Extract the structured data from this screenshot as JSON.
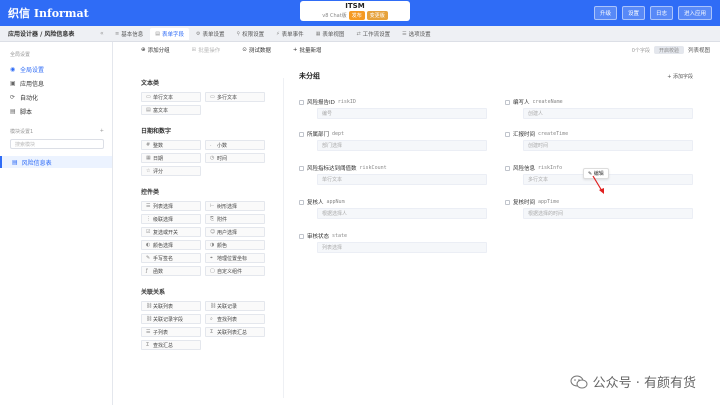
{
  "header": {
    "logo_text": "织信 Informat",
    "app_title": "ITSM",
    "version": "v8 Chat版",
    "badge_publish": "发布",
    "badge_update": "变更版",
    "actions": [
      "升级",
      "设置",
      "日志",
      "进入应用"
    ]
  },
  "tabbar": {
    "breadcrumb": "应用设计器 / 风险信息表",
    "collapse": "«",
    "tabs": [
      {
        "label": "基本信息",
        "icon": "≡"
      },
      {
        "label": "表单字段",
        "icon": "▤"
      },
      {
        "label": "表单设置",
        "icon": "⚙"
      },
      {
        "label": "权限设置",
        "icon": "⚲"
      },
      {
        "label": "表单事件",
        "icon": "⚡"
      },
      {
        "label": "表单视图",
        "icon": "▦"
      },
      {
        "label": "工作流设置",
        "icon": "⇄"
      },
      {
        "label": "选项设置",
        "icon": "☰"
      }
    ],
    "active_tab": 1
  },
  "sidebar": {
    "section_label": "全局设置",
    "items": [
      {
        "label": "全局设置",
        "icon": "◉"
      },
      {
        "label": "应用信息",
        "icon": "▣"
      },
      {
        "label": "自动化",
        "icon": "⟳"
      },
      {
        "label": "脚本",
        "icon": "▤"
      }
    ],
    "group_label": "模块设置1",
    "group_add": "+",
    "search_placeholder": "搜索模块",
    "form_item": "风险信息表"
  },
  "toolbar": {
    "buttons": [
      "添加分组",
      "批量操作",
      "测试数据",
      "批量新增"
    ],
    "right_label": "0个字段",
    "switch_label": "开启校验",
    "view_label": "列表视图"
  },
  "palette": [
    {
      "category": "文本类",
      "items": [
        "单行文本",
        "多行文本",
        "富文本"
      ]
    },
    {
      "category": "日期和数字",
      "items": [
        "整数",
        "小数",
        "日期",
        "时间",
        "评分"
      ]
    },
    {
      "category": "控件类",
      "items": [
        "列表选择",
        "树形选择",
        "级联选择",
        "附件",
        "复选或开关",
        "用户选择",
        "颜色选择",
        "颜色",
        "手写签名",
        "地理位置坐标",
        "函数",
        "自定义组件"
      ]
    },
    {
      "category": "关联关系",
      "items": [
        "关联列表",
        "关联记录",
        "关联记录字段",
        "查找列表",
        "子列表",
        "关联列表汇总",
        "查找汇总"
      ]
    }
  ],
  "canvas": {
    "group_title": "未分组",
    "add_field": "添加字段",
    "edit_label": "编辑",
    "fields": [
      {
        "label": "风险报告ID",
        "key": "riskID",
        "placeholder": "编号"
      },
      {
        "label": "编写人",
        "key": "createName",
        "placeholder": "创建人"
      },
      {
        "label": "所属部门",
        "key": "dept",
        "placeholder": "部门选择"
      },
      {
        "label": "汇报时间",
        "key": "createTime",
        "placeholder": "创建时间"
      },
      {
        "label": "风险指标达到阈值数",
        "key": "riskCount",
        "placeholder": "单行文本"
      },
      {
        "label": "风险信息",
        "key": "riskInfo",
        "placeholder": "多行文本"
      },
      {
        "label": "复核人",
        "key": "appNum",
        "placeholder": "根据选择人"
      },
      {
        "label": "复核时间",
        "key": "appTime",
        "placeholder": "根据选择的时间"
      },
      {
        "label": "审核状态",
        "key": "state",
        "placeholder": "列表选择"
      }
    ]
  },
  "watermark": "公众号 · 有颜有货",
  "colors": {
    "primary": "#2f6cf6",
    "header_bg": "#2f6cf6",
    "arrow": "#e02020"
  }
}
